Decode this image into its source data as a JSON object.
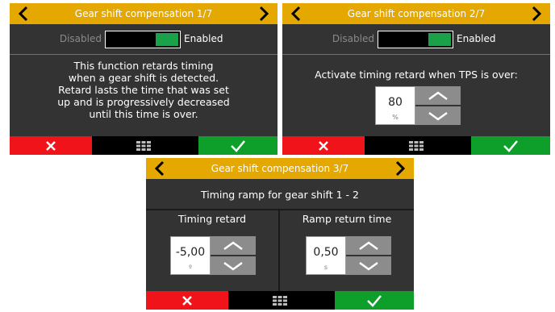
{
  "screen1": {
    "title": "Gear shift compensation 1/7",
    "toggle": {
      "off_label": "Disabled",
      "on_label": "Enabled",
      "state": "on"
    },
    "description": [
      "This function retards timing",
      "when a gear shift is detected.",
      "Retard lasts the time that was set",
      "up and is progressively decreased",
      "until this time is over."
    ]
  },
  "screen2": {
    "title": "Gear shift compensation 2/7",
    "toggle": {
      "off_label": "Disabled",
      "on_label": "Enabled",
      "state": "on"
    },
    "prompt": "Activate timing retard when TPS is over:",
    "field": {
      "value": "80",
      "unit": "%"
    }
  },
  "screen3": {
    "title": "Gear shift compensation 3/7",
    "subtitle": "Timing ramp for gear shift 1 - 2",
    "left": {
      "label": "Timing retard",
      "value": "-5,00",
      "unit": "º"
    },
    "right": {
      "label": "Ramp return time",
      "value": "0,50",
      "unit": "s"
    }
  },
  "colors": {
    "title_bar": "#e5a800",
    "background": "#333333",
    "cancel": "#f0131a",
    "confirm": "#0e9f2a",
    "toggle_on": "#1ca14b"
  },
  "icons": {
    "prev": "chevron-left-icon",
    "next": "chevron-right-icon",
    "cancel": "x-icon",
    "menu": "grid-icon",
    "confirm": "check-icon",
    "increase": "chevron-up-icon",
    "decrease": "chevron-down-icon"
  }
}
